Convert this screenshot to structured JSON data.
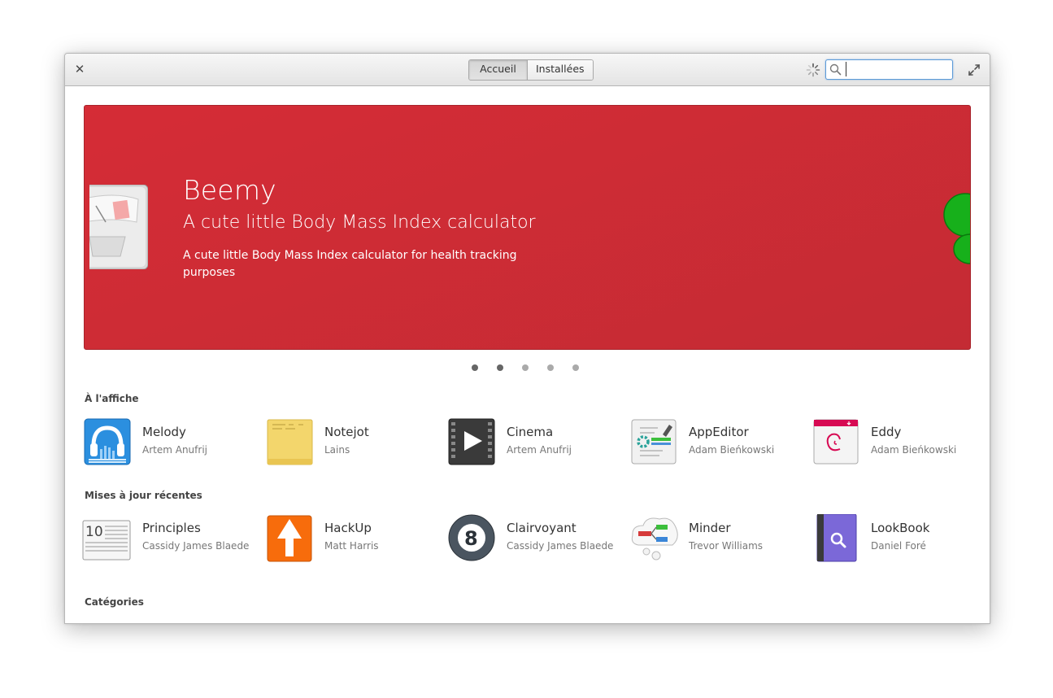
{
  "header": {
    "modes": [
      {
        "label": "Accueil",
        "active": true
      },
      {
        "label": "Installées",
        "active": false
      }
    ],
    "search_value": ""
  },
  "banner": {
    "title": "Beemy",
    "summary": "A cute little Body Mass Index calculator",
    "description": "A cute little Body Mass Index calculator for health tracking purposes",
    "color": "#d0293a",
    "page_count": 5,
    "current_page": 2
  },
  "sections": {
    "featured": "À l'affiche",
    "recent": "Mises à jour récentes",
    "categories": "Catégories"
  },
  "featured_apps": [
    {
      "name": "Melody",
      "author": "Artem Anufrij",
      "icon": "headphones-equalizer-icon"
    },
    {
      "name": "Notejot",
      "author": "Lains",
      "icon": "sticky-note-icon"
    },
    {
      "name": "Cinema",
      "author": "Artem Anufrij",
      "icon": "film-play-icon"
    },
    {
      "name": "AppEditor",
      "author": "Adam Bieńkowski",
      "icon": "app-editor-icon"
    },
    {
      "name": "Eddy",
      "author": "Adam Bieńkowski",
      "icon": "debian-package-icon"
    }
  ],
  "recent_apps": [
    {
      "name": "Principles",
      "author": "Cassidy James Blaede",
      "icon": "newspaper-icon"
    },
    {
      "name": "HackUp",
      "author": "Matt Harris",
      "icon": "upvote-arrow-icon"
    },
    {
      "name": "Clairvoyant",
      "author": "Cassidy James Blaede",
      "icon": "magic-8-ball-icon"
    },
    {
      "name": "Minder",
      "author": "Trevor Williams",
      "icon": "mind-map-cloud-icon"
    },
    {
      "name": "LookBook",
      "author": "Daniel Foré",
      "icon": "search-book-icon"
    }
  ]
}
